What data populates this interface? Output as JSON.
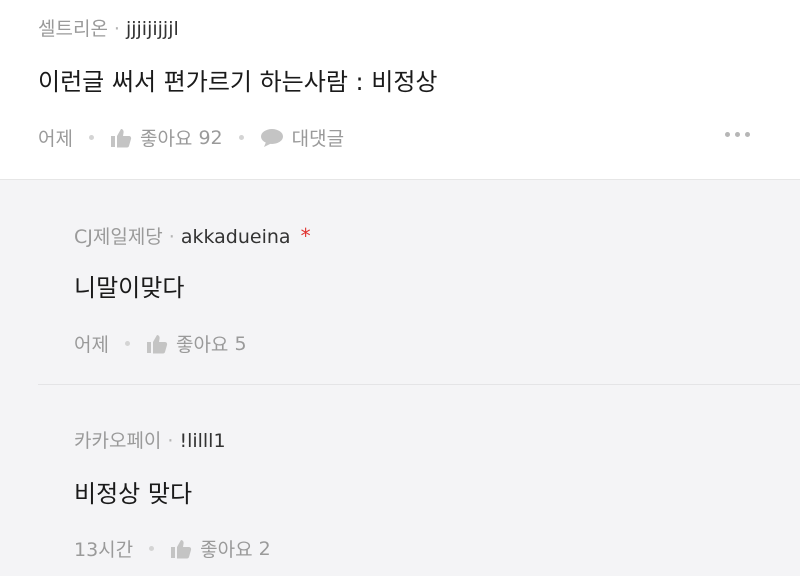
{
  "post": {
    "author_company": "셀트리온",
    "author_id": "jjjijijjjl",
    "text": "이런글 써서 편가르기 하는사람 : 비정상",
    "time": "어제",
    "like_label": "좋아요",
    "like_count": "92",
    "reply_label": "대댓글"
  },
  "replies": [
    {
      "author_company": "CJ제일제당",
      "author_id": "akkadueina",
      "badge": "*",
      "text": "니말이맞다",
      "time": "어제",
      "like_label": "좋아요",
      "like_count": "5"
    },
    {
      "author_company": "카카오페이",
      "author_id": "!lilll1",
      "text": "비정상 맞다",
      "time": "13시간",
      "like_label": "좋아요",
      "like_count": "2"
    }
  ],
  "colors": {
    "background": "#ffffff",
    "reply_background": "#f4f4f6",
    "meta_text": "#9a9a9a",
    "badge": "#e0322f"
  },
  "icons": [
    "thumbs-up-icon",
    "speech-bubble-icon",
    "more-dots-icon"
  ]
}
